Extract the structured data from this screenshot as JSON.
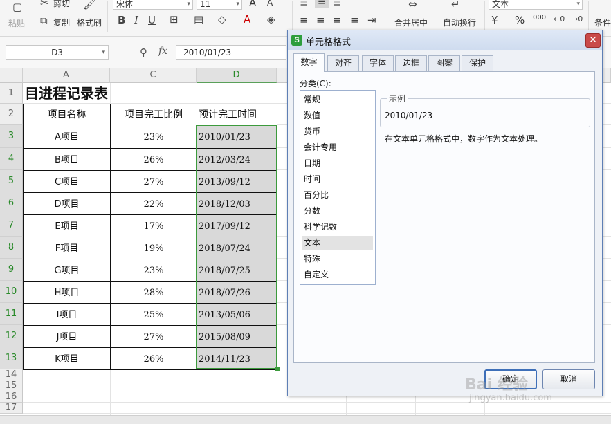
{
  "ribbon": {
    "cut_label": "剪切",
    "paste_label": "粘贴",
    "copy_label": "复制",
    "format_painter_label": "格式刷",
    "font_name": "宋体",
    "font_size": "11",
    "font_grow_label": "A",
    "font_shrink_label": "A",
    "merge_center_label": "合并居中",
    "wrap_text_label": "自动换行",
    "number_format": "文本",
    "percent_label": "%",
    "thousands_label": "000",
    "conditional_label": "条件"
  },
  "formula_bar": {
    "name_box": "D3",
    "fx_label": "fx",
    "value": "2010/01/23"
  },
  "sheet": {
    "columns": [
      "A",
      "C",
      "D"
    ],
    "rows": [
      "1",
      "2",
      "3",
      "4",
      "5",
      "6",
      "7",
      "8",
      "9",
      "10",
      "11",
      "12",
      "13",
      "14",
      "15",
      "16",
      "17"
    ],
    "title": "目进程记录表",
    "headers": [
      "项目名称",
      "项目完工比例",
      "预计完工时间"
    ],
    "data": [
      [
        "A项目",
        "23%",
        "2010/01/23"
      ],
      [
        "B项目",
        "26%",
        "2012/03/24"
      ],
      [
        "C项目",
        "27%",
        "2013/09/12"
      ],
      [
        "D项目",
        "22%",
        "2018/12/03"
      ],
      [
        "E项目",
        "17%",
        "2017/09/12"
      ],
      [
        "F项目",
        "19%",
        "2018/07/24"
      ],
      [
        "G项目",
        "23%",
        "2018/07/25"
      ],
      [
        "H项目",
        "28%",
        "2018/07/26"
      ],
      [
        "I项目",
        "25%",
        "2013/05/06"
      ],
      [
        "J项目",
        "27%",
        "2015/08/09"
      ],
      [
        "K项目",
        "26%",
        "2014/11/23"
      ]
    ]
  },
  "dialog": {
    "title": "单元格格式",
    "close_glyph": "✕",
    "tabs": [
      "数字",
      "对齐",
      "字体",
      "边框",
      "图案",
      "保护"
    ],
    "category_label": "分类(C):",
    "categories": [
      "常规",
      "数值",
      "货币",
      "会计专用",
      "日期",
      "时间",
      "百分比",
      "分数",
      "科学记数",
      "文本",
      "特殊",
      "自定义"
    ],
    "selected_category": "文本",
    "sample_title": "示例",
    "sample_value": "2010/01/23",
    "description": "在文本单元格格式中，数字作为文本处理。",
    "ok_label": "确定",
    "cancel_label": "取消"
  },
  "watermark": {
    "text": "Bai 经验",
    "sub": "jingyan.baidu.com"
  },
  "colors": {
    "selection_border": "#3c9a3c",
    "selected_fill": "#d9d9d9",
    "dialog_border": "#5e7fb5"
  }
}
